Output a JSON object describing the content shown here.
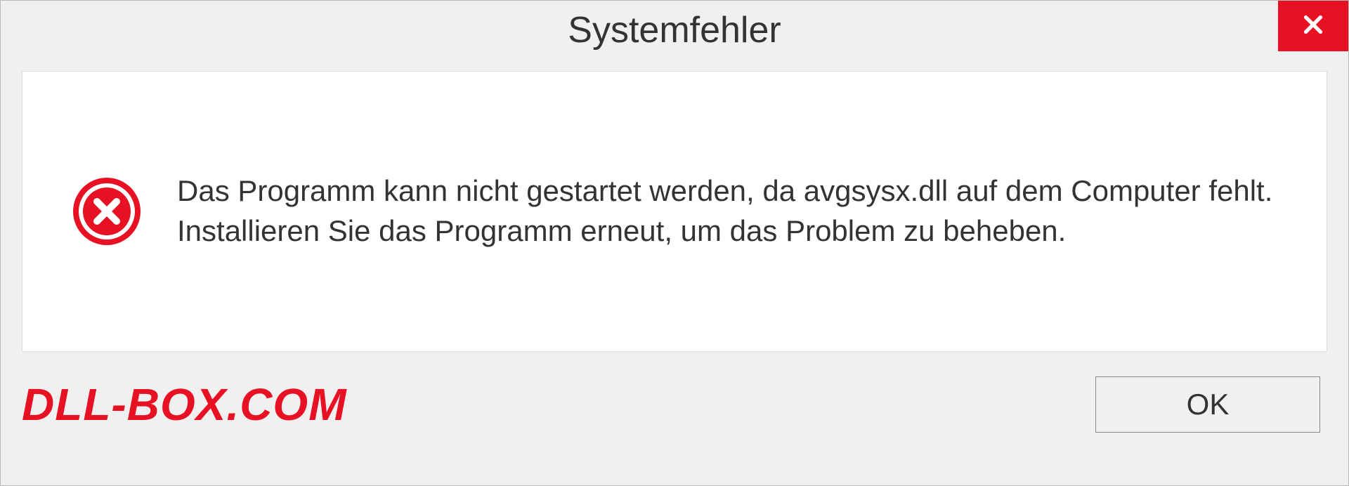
{
  "dialog": {
    "title": "Systemfehler",
    "message": "Das Programm kann nicht gestartet werden, da avgsysx.dll auf dem Computer fehlt. Installieren Sie das Programm erneut, um das Problem zu beheben.",
    "ok_label": "OK",
    "watermark": "DLL-BOX.COM"
  },
  "colors": {
    "close_bg": "#e81123",
    "error_icon": "#e81123",
    "watermark": "#e81123"
  }
}
